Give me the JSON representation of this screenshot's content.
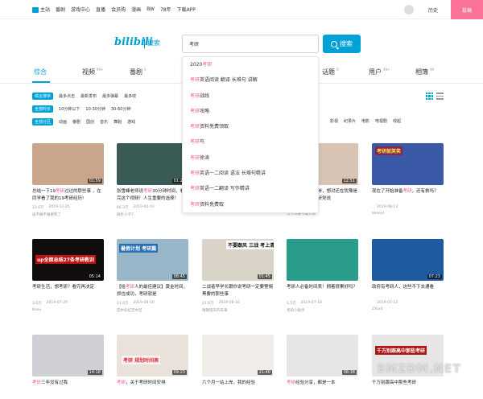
{
  "nav": {
    "items": [
      "主站",
      "番剧",
      "游戏中心",
      "直播",
      "会员购",
      "漫画",
      "BW",
      "78年",
      "下载APP"
    ],
    "history": "历史",
    "post": "投稿"
  },
  "brand": {
    "logo": "bilibili",
    "sub": "搜索"
  },
  "search": {
    "value": "考研",
    "button": "搜索"
  },
  "suggestions": [
    {
      "pre": "2020",
      "hl": "考研",
      "post": ""
    },
    {
      "pre": "",
      "hl": "考研",
      "post": "英语阅读 翻译 长难句 讲解"
    },
    {
      "pre": "",
      "hl": "考研",
      "post": "战线"
    },
    {
      "pre": "",
      "hl": "考研",
      "post": "攻略"
    },
    {
      "pre": "",
      "hl": "考研",
      "post": "资料免费领取"
    },
    {
      "pre": "",
      "hl": "考研",
      "post": "鸟"
    },
    {
      "pre": "",
      "hl": "考研",
      "post": "徐涛"
    },
    {
      "pre": "",
      "hl": "考研",
      "post": "英语一二阅读 语法 长难句精讲"
    },
    {
      "pre": "",
      "hl": "考研",
      "post": "英语一二翻译 写作精讲"
    },
    {
      "pre": "",
      "hl": "考研",
      "post": "资料免费取"
    }
  ],
  "tabs": [
    {
      "label": "综合",
      "count": ""
    },
    {
      "label": "视频",
      "count": "99+"
    },
    {
      "label": "番剧",
      "count": "0"
    },
    {
      "label": "话题",
      "count": "0"
    },
    {
      "label": "用户",
      "count": "99+"
    },
    {
      "label": "相簿",
      "count": "99"
    }
  ],
  "filters": {
    "order": {
      "chip": "综合排序",
      "items": [
        "最多点击",
        "最新发布",
        "最多弹幕",
        "最多收"
      ]
    },
    "duration": {
      "chip": "全部时长",
      "items": [
        "10分钟以下",
        "10-30分钟",
        "30-60分钟"
      ]
    },
    "zone": {
      "chip": "全部分区",
      "items": [
        "动画",
        "番剧",
        "国创",
        "音乐",
        "舞蹈",
        "游戏"
      ],
      "right": [
        "影视",
        "纪录片",
        "电影",
        "电视剧",
        "收起"
      ]
    }
  },
  "colors": {
    "accent": "#00a1d6",
    "pink": "#fb7299",
    "highlight": "#f25d8e"
  },
  "videos": [
    {
      "title_pre": "总结一下19",
      "hl": "考研",
      "title_post": "过过的那些事 ，在同学看了我的19考研经历!",
      "dur": "01:59",
      "views": "23.6万",
      "date": "2019-12-25",
      "author": "再不做不做要死了"
    },
    {
      "title_pre": "张雪峰老师说",
      "hl": "考研",
      "title_post": "30分钟时间，看完这个视频！人生重要的选择！",
      "dur": "01:25",
      "views": "66.3万",
      "date": "2019-02-03",
      "author": "微步小子7"
    },
    {
      "title_pre": "",
      "hl": "",
      "title_post": "",
      "dur": "",
      "views": "",
      "date": "",
      "author": ""
    },
    {
      "title_pre": "一战",
      "hl": "考研",
      "title_post": "成功上岸，想对还在犹豫是否一些几个今考研党说",
      "dur": "12:51",
      "views": "",
      "date": "2019-07-12",
      "author": "为什么要不做大哥"
    },
    {
      "title_pre": "现在了开始准备",
      "hl": "考研",
      "title_post": "，还有救吗？",
      "dur": "",
      "views": "",
      "date": "2019-08-13",
      "author": "keeeys"
    },
    {
      "title_pre": "考研",
      "hl": "",
      "title_post": "生活，想考研？看完再决定",
      "dur": "05:14",
      "views": "3.6万",
      "date": "2019-07-29",
      "author": "Kaou"
    },
    {
      "title_pre": "【给",
      "hl": "考研",
      "title_post": "人的最佳建议】黄金时间，抓住成功，考研就是",
      "dur": "08:45",
      "views": "11.4万",
      "date": "2019-08-10",
      "author": "空中彩虹空中空"
    },
    {
      "title_pre": "二战",
      "hl": "",
      "title_post": "者早学长跟你说考研一定要警惕黑要的那些事",
      "dur": "01:45",
      "views": "21.6万",
      "date": "2019-08-16",
      "author": "晴朗雨天的未来"
    },
    {
      "title_pre": "考研",
      "hl": "",
      "title_post": "人必备时间表！拥着很累好吗？",
      "dur": "",
      "views": "1.5万",
      "date": "2019-07-18",
      "author": "考研小助手"
    },
    {
      "title_pre": "政府有考研",
      "hl": "",
      "title_post": "人，这些不下去通看",
      "dur": "07:23",
      "views": "",
      "date": "2019-07-12",
      "author": "ZXunt"
    },
    {
      "title_pre": "",
      "hl": "考研",
      "title_post": "三年没有过我",
      "dur": "14:18",
      "views": "",
      "date": "",
      "author": ""
    },
    {
      "title_pre": "",
      "hl": "考研",
      "title_post": "，关于考研时间安排",
      "dur": "09:23",
      "views": "",
      "date": "",
      "author": ""
    },
    {
      "title_pre": "六个月一站上岸",
      "hl": "",
      "title_post": "，我的经验",
      "dur": "21:40",
      "views": "",
      "date": "",
      "author": ""
    },
    {
      "title_pre": "",
      "hl": "考研",
      "title_post": "经验分享，都是一本",
      "dur": "08:38",
      "views": "",
      "date": "",
      "author": ""
    },
    {
      "title_pre": "千万别跟高中那些考研",
      "hl": "",
      "title_post": "",
      "dur": "",
      "views": "",
      "date": "",
      "author": ""
    }
  ],
  "thumbs": [
    {
      "overlay": ""
    },
    {
      "overlay": ""
    },
    {
      "overlay": ""
    },
    {
      "overlay": ""
    },
    {
      "overlay": "考研就笑笑"
    },
    {
      "overlay": "up全面总结27条考研教训"
    },
    {
      "overlay": "暑假计划 考研篇"
    },
    {
      "overlay": "不要跟风 三战 考上清华"
    },
    {
      "overlay": ""
    },
    {
      "overlay": ""
    },
    {
      "overlay": ""
    },
    {
      "overlay": "考研 规划时间表"
    },
    {
      "overlay": ""
    },
    {
      "overlay": ""
    },
    {
      "overlay": "千万别跟高中那些考研"
    }
  ],
  "watermark": "SMZDM.NET"
}
